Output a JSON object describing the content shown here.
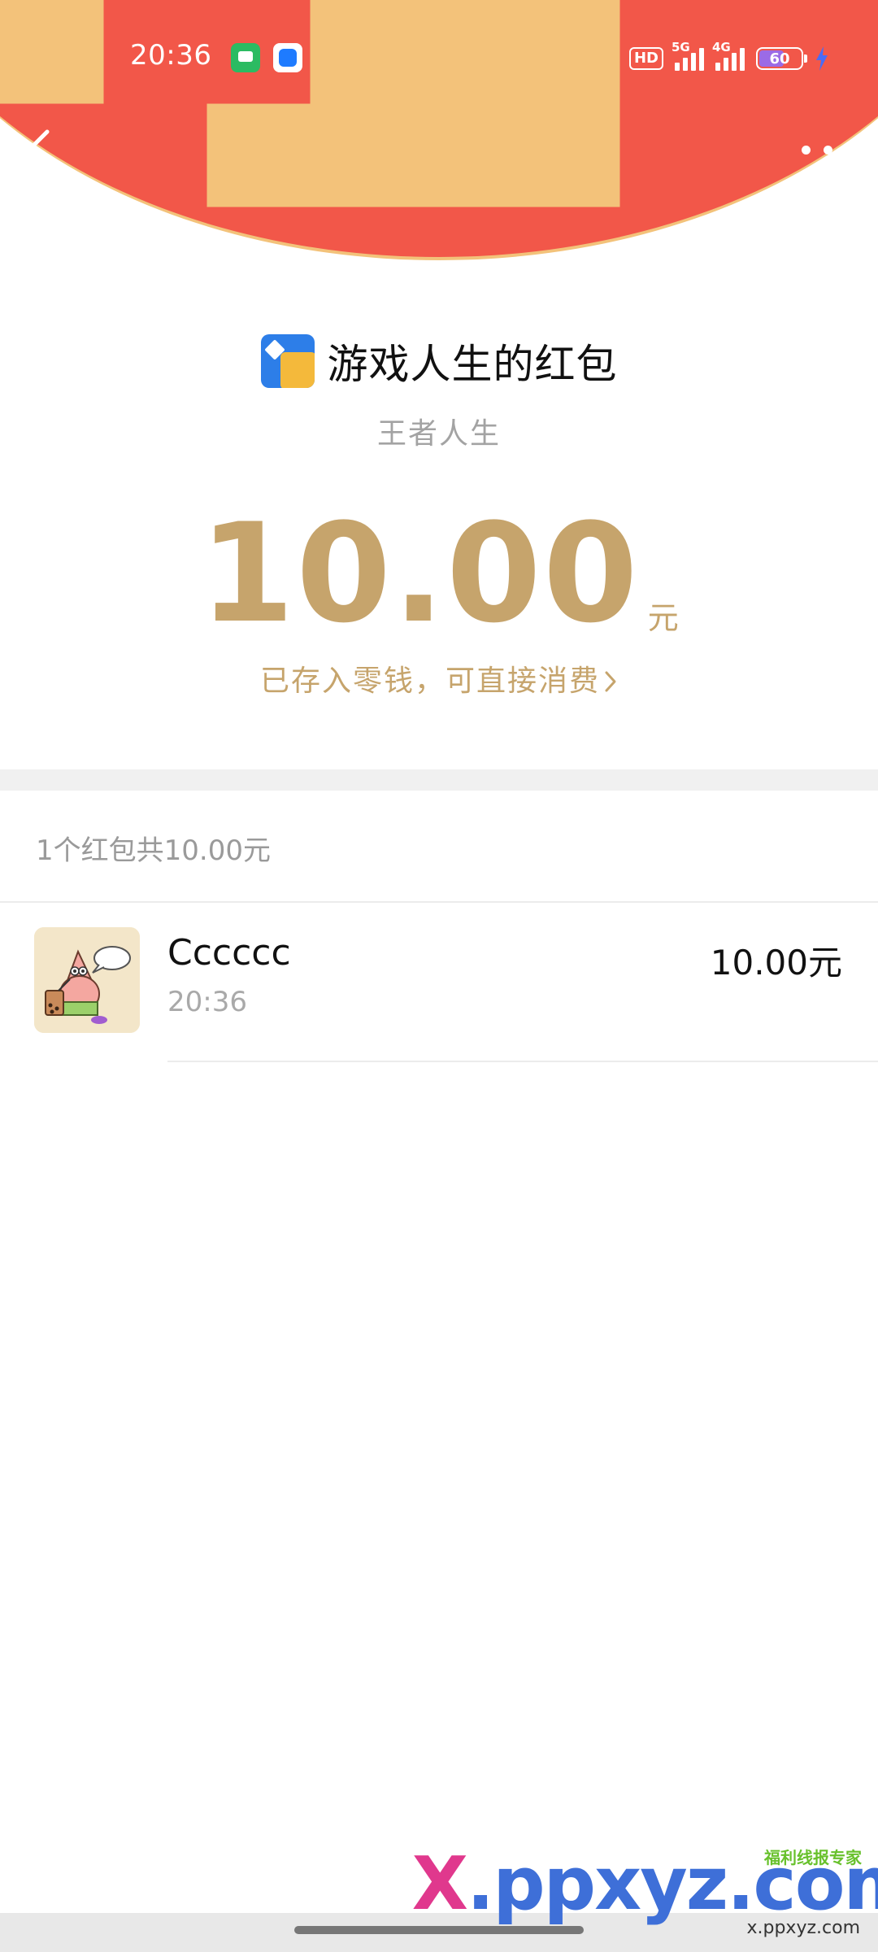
{
  "status_bar": {
    "time": "20:36",
    "network_hd": "HD",
    "network_1": "5G",
    "network_2": "4G",
    "battery": "60"
  },
  "header": {
    "background_color": "#f25749",
    "back_icon": "chevron-left-icon",
    "more_icon": "more-dots-icon"
  },
  "sender": {
    "title": "游戏人生的红包",
    "subtitle": "王者人生"
  },
  "amount": {
    "value": "10.00",
    "unit": "元",
    "note": "已存入零钱，可直接消费"
  },
  "summary": {
    "text": "1个红包共10.00元"
  },
  "records": [
    {
      "name": "Cccccc",
      "time": "20:36",
      "amount": "10.00元"
    }
  ],
  "watermark": {
    "text_x": "X",
    "text_rest": ".ppxyz.com",
    "tag": "福利线报专家",
    "url": "x.ppxyz.com"
  }
}
